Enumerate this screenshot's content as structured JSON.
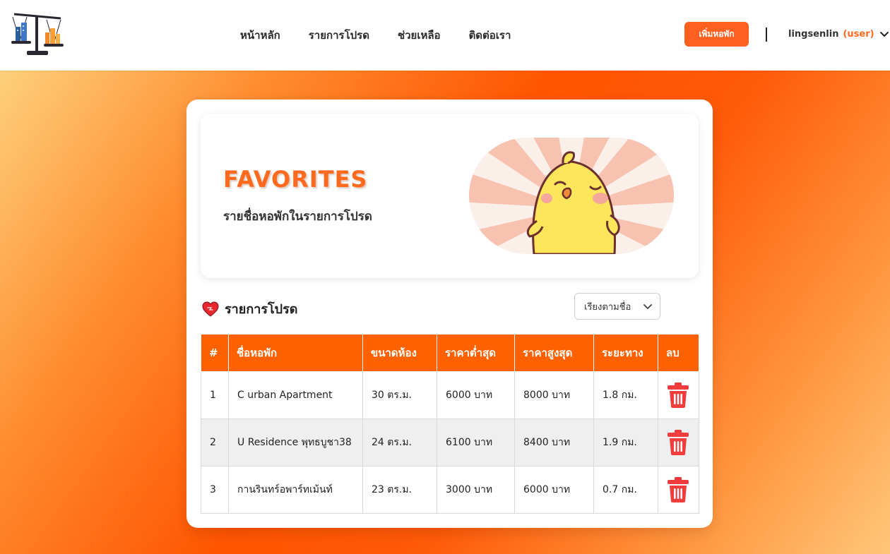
{
  "nav": {
    "links": [
      "หน้าหลัก",
      "รายการโปรด",
      "ช่วยเหลือ",
      "ติดต่อเรา"
    ],
    "add_button": "เพิ่มหอพัก",
    "user": "lingsenlin",
    "role": "(user)"
  },
  "hero": {
    "title": "FAVORITES",
    "subtitle": "รายชื่อหอพักในรายการโปรด"
  },
  "list": {
    "title": "รายการโปรด",
    "sort_label": "เรียงตามชื่อ"
  },
  "table": {
    "headers": [
      "#",
      "ชื่อหอพัก",
      "ขนาดห้อง",
      "ราคาต่ำสุด",
      "ราคาสูงสุด",
      "ระยะทาง",
      "ลบ"
    ],
    "rows": [
      {
        "num": "1",
        "name": "C urban Apartment",
        "size": "30 ตร.ม.",
        "min_price": "6000 บาท",
        "max_price": "8000 บาท",
        "distance": "1.8 กม."
      },
      {
        "num": "2",
        "name": "U Residence พุทธบูชา38",
        "size": "24 ตร.ม.",
        "min_price": "6100 บาท",
        "max_price": "8400 บาท",
        "distance": "1.9 กม."
      },
      {
        "num": "3",
        "name": "กานรินทร์อพาร์ทเม้นท์",
        "size": "23 ตร.ม.",
        "min_price": "3000 บาท",
        "max_price": "6000 บาท",
        "distance": "0.7 กม."
      }
    ]
  },
  "colors": {
    "accent": "#ff5f1f",
    "table_header": "#ff6000",
    "delete": "#f23c3c"
  },
  "icons": {
    "logo": "scale-buildings-logo",
    "user_menu": "chevron-down-icon",
    "list": "heart-icon",
    "delete": "trash-icon"
  }
}
